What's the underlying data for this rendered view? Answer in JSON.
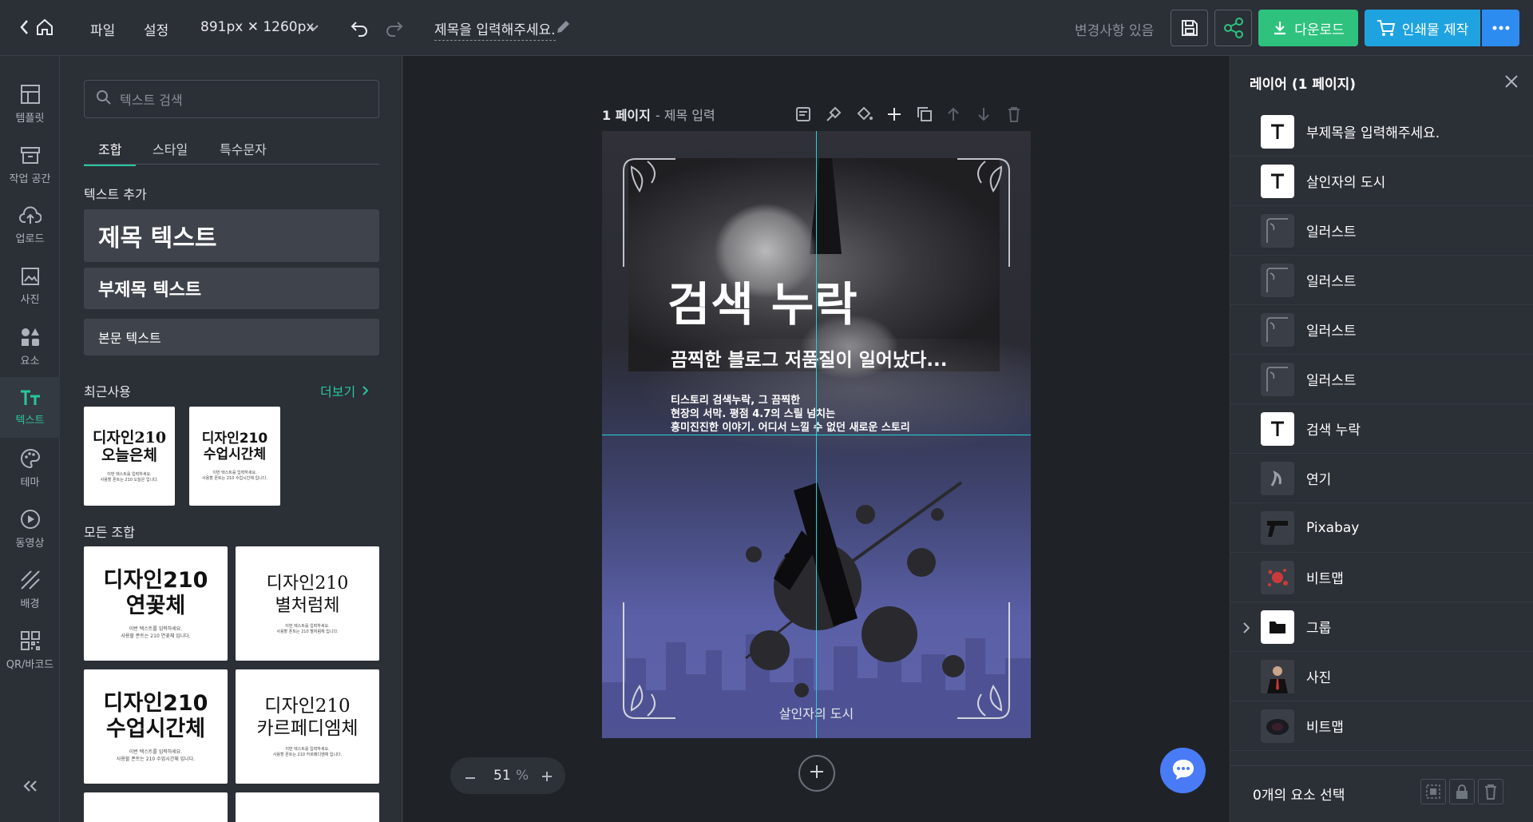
{
  "topbar": {
    "file_menu": "파일",
    "settings_menu": "설정",
    "size_label": "891px ✕ 1260px",
    "doc_title": "제목을 입력해주세요.",
    "status": "변경사항 있음",
    "download_label": "다운로드",
    "print_label": "인쇄물 제작"
  },
  "leftnav": {
    "items": [
      {
        "label": "템플릿",
        "icon": "template-icon"
      },
      {
        "label": "작업 공간",
        "icon": "workspace-icon"
      },
      {
        "label": "업로드",
        "icon": "upload-icon"
      },
      {
        "label": "사진",
        "icon": "photo-icon"
      },
      {
        "label": "요소",
        "icon": "elements-icon"
      },
      {
        "label": "텍스트",
        "icon": "text-icon"
      },
      {
        "label": "테마",
        "icon": "palette-icon"
      },
      {
        "label": "동영상",
        "icon": "video-icon"
      },
      {
        "label": "배경",
        "icon": "background-icon"
      },
      {
        "label": "QR/바코드",
        "icon": "qr-icon"
      }
    ],
    "active": "텍스트"
  },
  "panel": {
    "search_placeholder": "텍스트 검색",
    "tabs": [
      "조합",
      "스타일",
      "특수문자"
    ],
    "add_text_title": "텍스트 추가",
    "heading_text": "제목 텍스트",
    "subheading_text": "부제목 텍스트",
    "body_text": "본문 텍스트",
    "recent_title": "최근사용",
    "more_label": "더보기",
    "recent": [
      {
        "title": "디자인210\n오늘은체",
        "caption": "이번 텍스트를 입력하세요.\n사용할 폰트는 210 오늘은 입니다."
      },
      {
        "title": "디자인210\n수업시간체",
        "caption": "이번 텍스트를 입력하세요.\n사용할 폰트는 210 수업시간체 입니다."
      }
    ],
    "all_title": "모든 조합",
    "all": [
      {
        "title": "디자인210\n연꽃체",
        "caption": "이번 텍스트를 입력하세요.\n사용할 폰트는 210 연꽃체 입니다."
      },
      {
        "title": "디자인210\n별처럼체",
        "caption": "이번 텍스트를 입력하세요.\n사용할 폰트는 210 별처럼체 입니다."
      },
      {
        "title": "디자인210\n수업시간체",
        "caption": "이번 텍스트를 입력하세요.\n사용할 폰트는 210 수업시간체 입니다."
      },
      {
        "title": "디자인210\n카르페디엠체",
        "caption": "이번 텍스트를 입력하세요.\n사용할 폰트는 210 카르페디엠체 입니다."
      }
    ]
  },
  "canvas": {
    "page_label": "1 페이지",
    "page_title": "- 제목 입력",
    "design_title": "검색 누락",
    "design_subtitle": "끔찍한 블로그 저품질이 일어났다...",
    "design_body_1": "티스토리 검색누락, 그 끔찍한",
    "design_body_2": "현장의 서막. 평점 4.7의 스릴 넘치는",
    "design_body_3": "흥미진진한 이야기. 어디서 느낄 수 없던 새로운 스토리",
    "design_footer": "살인자의 도시",
    "zoom_value": "51",
    "zoom_unit": "%"
  },
  "layers": {
    "title": "레이어 (1 페이지)",
    "items": [
      {
        "name": "부제목을 입력해주세요.",
        "kind": "text"
      },
      {
        "name": "살인자의 도시",
        "kind": "text"
      },
      {
        "name": "일러스트",
        "kind": "ornament"
      },
      {
        "name": "일러스트",
        "kind": "ornament"
      },
      {
        "name": "일러스트",
        "kind": "ornament"
      },
      {
        "name": "일러스트",
        "kind": "ornament"
      },
      {
        "name": "검색 누락",
        "kind": "text"
      },
      {
        "name": "연기",
        "kind": "smoke"
      },
      {
        "name": "Pixabay",
        "kind": "gun"
      },
      {
        "name": "비트맵",
        "kind": "splatter"
      },
      {
        "name": "그룹",
        "kind": "folder"
      },
      {
        "name": "사진",
        "kind": "photo"
      },
      {
        "name": "비트맵",
        "kind": "bitmap"
      }
    ],
    "selection_status": "0개의 요소 선택"
  },
  "colors": {
    "accent": "#28c6a0",
    "download_bg": "#2ec27e",
    "print_bg": "#1fa3e0",
    "more_bg": "#2d8cf0",
    "chat_bg": "#4a7bf7"
  }
}
